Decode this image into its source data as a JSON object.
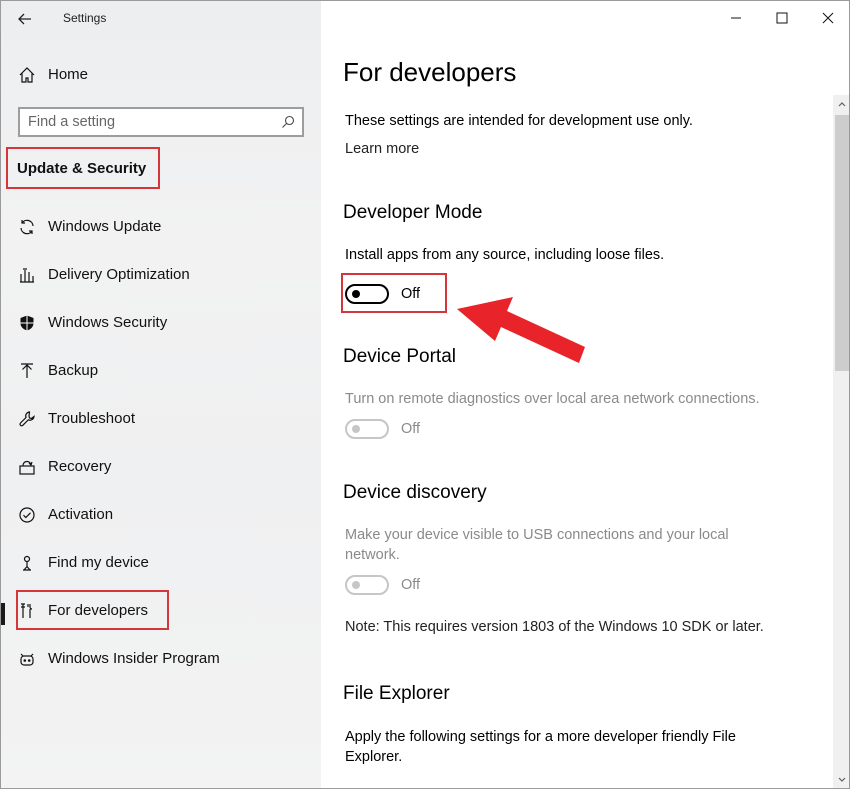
{
  "app": {
    "title": "Settings"
  },
  "sidebar": {
    "home_label": "Home",
    "search_placeholder": "Find a setting",
    "section_heading": "Update & Security",
    "items": [
      {
        "label": "Windows Update",
        "icon": "sync-icon"
      },
      {
        "label": "Delivery Optimization",
        "icon": "delivery-icon"
      },
      {
        "label": "Windows Security",
        "icon": "shield-icon"
      },
      {
        "label": "Backup",
        "icon": "backup-icon"
      },
      {
        "label": "Troubleshoot",
        "icon": "wrench-icon"
      },
      {
        "label": "Recovery",
        "icon": "recovery-icon"
      },
      {
        "label": "Activation",
        "icon": "check-circle-icon"
      },
      {
        "label": "Find my device",
        "icon": "person-pin-icon"
      },
      {
        "label": "For developers",
        "icon": "developer-tools-icon",
        "selected": true
      },
      {
        "label": "Windows Insider Program",
        "icon": "insider-icon"
      }
    ]
  },
  "content": {
    "title": "For developers",
    "intro": "These settings are intended for development use only.",
    "learn_more": "Learn more",
    "developer_mode": {
      "heading": "Developer Mode",
      "description": "Install apps from any source, including loose files.",
      "toggle_state": "Off"
    },
    "device_portal": {
      "heading": "Device Portal",
      "description": "Turn on remote diagnostics over local area network connections.",
      "toggle_state": "Off"
    },
    "device_discovery": {
      "heading": "Device discovery",
      "description_line1": "Make your device visible to USB connections and your local",
      "description_line2": "network.",
      "toggle_state": "Off",
      "note": "Note: This requires version 1803 of the Windows 10 SDK or later."
    },
    "file_explorer": {
      "heading": "File Explorer",
      "description_line1": "Apply the following settings for a more developer friendly File",
      "description_line2": "Explorer."
    }
  },
  "colors": {
    "highlight": "#d4363c",
    "arrow": "#e8232a",
    "disabled": "#8a8a8a"
  }
}
